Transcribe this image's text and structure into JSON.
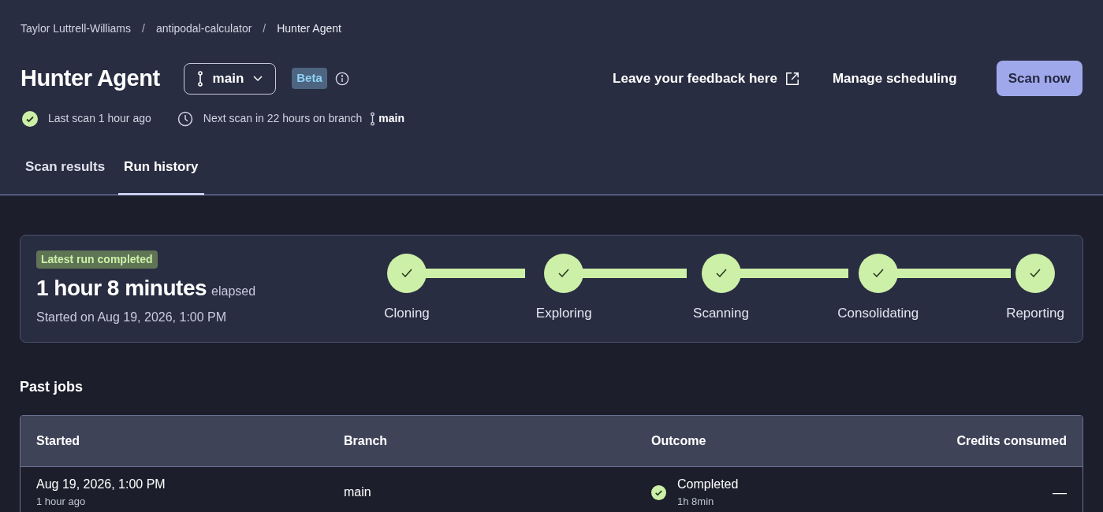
{
  "breadcrumbs": [
    {
      "label": "Taylor Luttrell-Williams",
      "separator": "/"
    },
    {
      "label": "antipodal-calculator",
      "separator": "/"
    },
    {
      "label": "Hunter Agent"
    }
  ],
  "title": "Hunter Agent",
  "branch_selector": {
    "value": "main"
  },
  "badge": "Beta",
  "actions": {
    "feedback_link": "Leave your feedback here",
    "manage_button": "Manage scheduling",
    "scan_button": "Scan now"
  },
  "status": {
    "last_scan": "Last scan 1 hour ago",
    "next_scan": "Next scan in 22 hours on branch",
    "branch": "main"
  },
  "tabs": [
    {
      "label": "Scan results",
      "selected": false
    },
    {
      "label": "Run history",
      "selected": true
    }
  ],
  "latest_run": {
    "badge": "Latest run completed",
    "duration": "1 hour 8 minutes",
    "suffix": "elapsed",
    "started": "Started on Aug 19, 2026, 1:00 PM",
    "steps": [
      {
        "label": "Cloning",
        "done": true
      },
      {
        "label": "Exploring",
        "done": true
      },
      {
        "label": "Scanning",
        "done": true
      },
      {
        "label": "Consolidating",
        "done": true
      },
      {
        "label": "Reporting",
        "done": true
      }
    ]
  },
  "past_jobs": {
    "heading": "Past jobs",
    "columns": [
      "Started",
      "Branch",
      "Outcome",
      "Credits consumed"
    ],
    "rows": [
      {
        "started": "Aug 19, 2026, 1:00 PM",
        "started_ago": "1 hour ago",
        "branch": "main",
        "outcome": "Completed",
        "success": true,
        "duration": "1h 8min",
        "credits": "—"
      }
    ]
  }
}
